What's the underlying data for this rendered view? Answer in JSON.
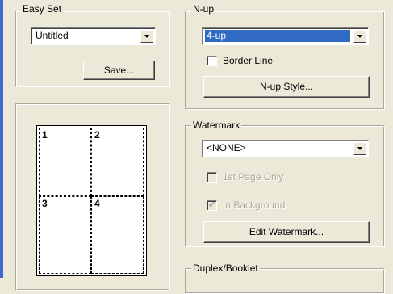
{
  "easy_set": {
    "legend": "Easy Set",
    "selected": "Untitled",
    "save_label": "Save..."
  },
  "preview": {
    "cells": [
      "1",
      "2",
      "3",
      "4"
    ]
  },
  "nup": {
    "legend": "N-up",
    "selected": "4-up",
    "border_line_label": "Border Line",
    "border_line_checked": false,
    "style_button_label": "N-up Style..."
  },
  "watermark": {
    "legend": "Watermark",
    "selected": "<NONE>",
    "first_page_only_label": "1st Page Only",
    "first_page_only_checked": false,
    "in_background_label": "In Background",
    "in_background_checked": true,
    "edit_button_label": "Edit Watermark..."
  },
  "duplex": {
    "legend": "Duplex/Booklet"
  },
  "colors": {
    "dialog_bg": "#ece9d8",
    "selection": "#316ac5",
    "outer_border": "#3b6bd1"
  }
}
